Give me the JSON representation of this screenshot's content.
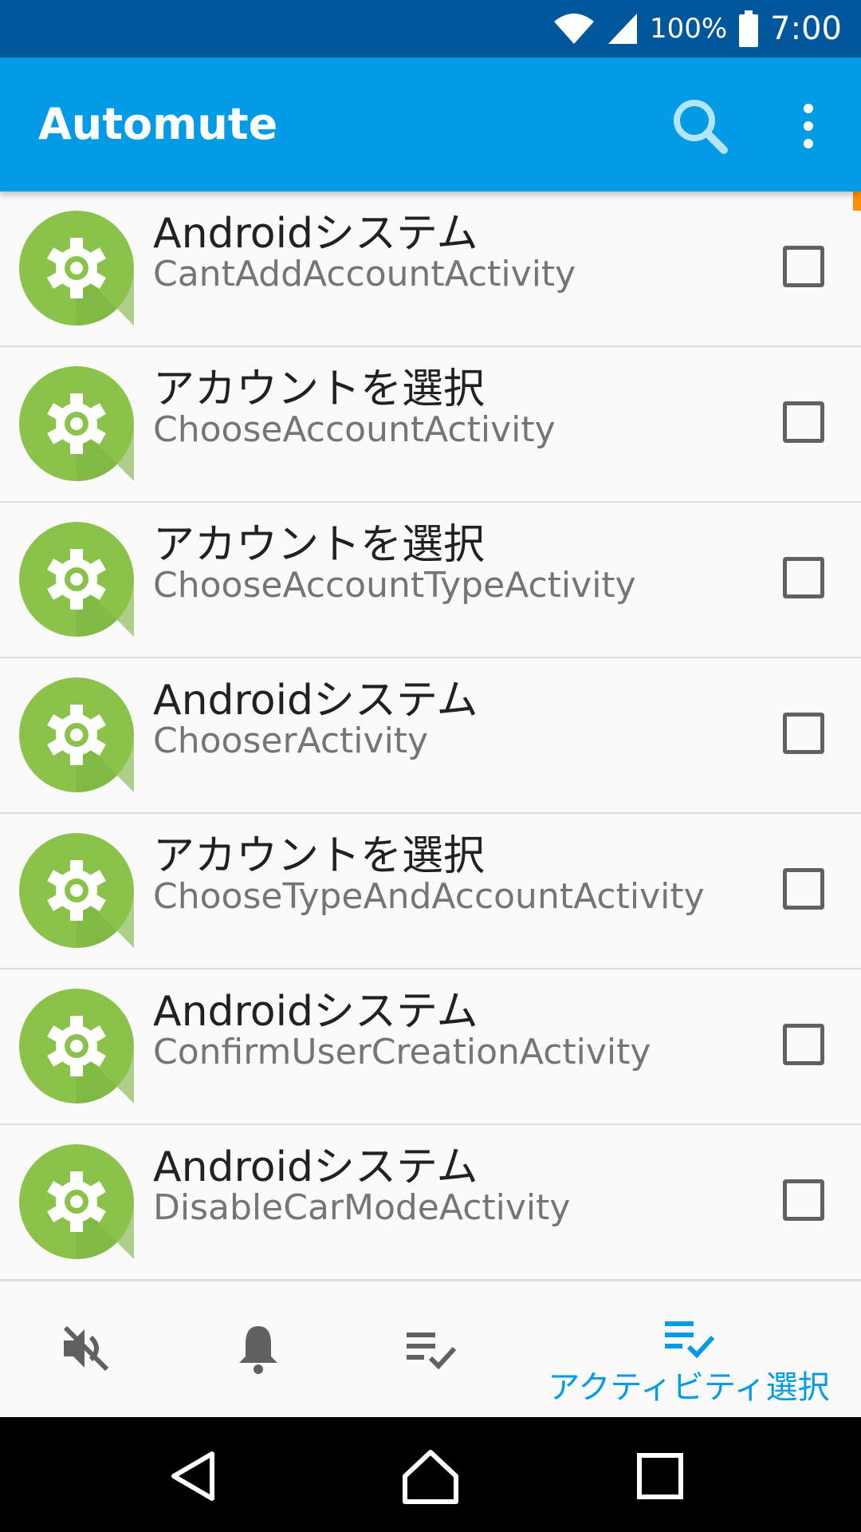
{
  "status_bar": {
    "battery": "100%",
    "time": "7:00"
  },
  "app_bar": {
    "title": "Automute"
  },
  "activities": [
    {
      "app": "Androidシステム",
      "activity": "CantAddAccountActivity",
      "checked": false
    },
    {
      "app": "アカウントを選択",
      "activity": "ChooseAccountActivity",
      "checked": false
    },
    {
      "app": "アカウントを選択",
      "activity": "ChooseAccountTypeActivity",
      "checked": false
    },
    {
      "app": "Androidシステム",
      "activity": "ChooserActivity",
      "checked": false
    },
    {
      "app": "アカウントを選択",
      "activity": "ChooseTypeAndAccountActivity",
      "checked": false
    },
    {
      "app": "Androidシステム",
      "activity": "ConfirmUserCreationActivity",
      "checked": false
    },
    {
      "app": "Androidシステム",
      "activity": "DisableCarModeActivity",
      "checked": false
    }
  ],
  "bottom_nav": {
    "items": [
      {
        "icon": "volume-off-icon",
        "label": ""
      },
      {
        "icon": "bell-icon",
        "label": ""
      },
      {
        "icon": "playlist-check-icon",
        "label": ""
      },
      {
        "icon": "playlist-check-icon",
        "label": "アクティビティ選択",
        "active": true
      }
    ]
  },
  "colors": {
    "status_bar": "#01579b",
    "app_bar": "#039be5",
    "accent": "#039be5",
    "icon_green": "#8bc34a",
    "inactive_icon": "#616161"
  }
}
